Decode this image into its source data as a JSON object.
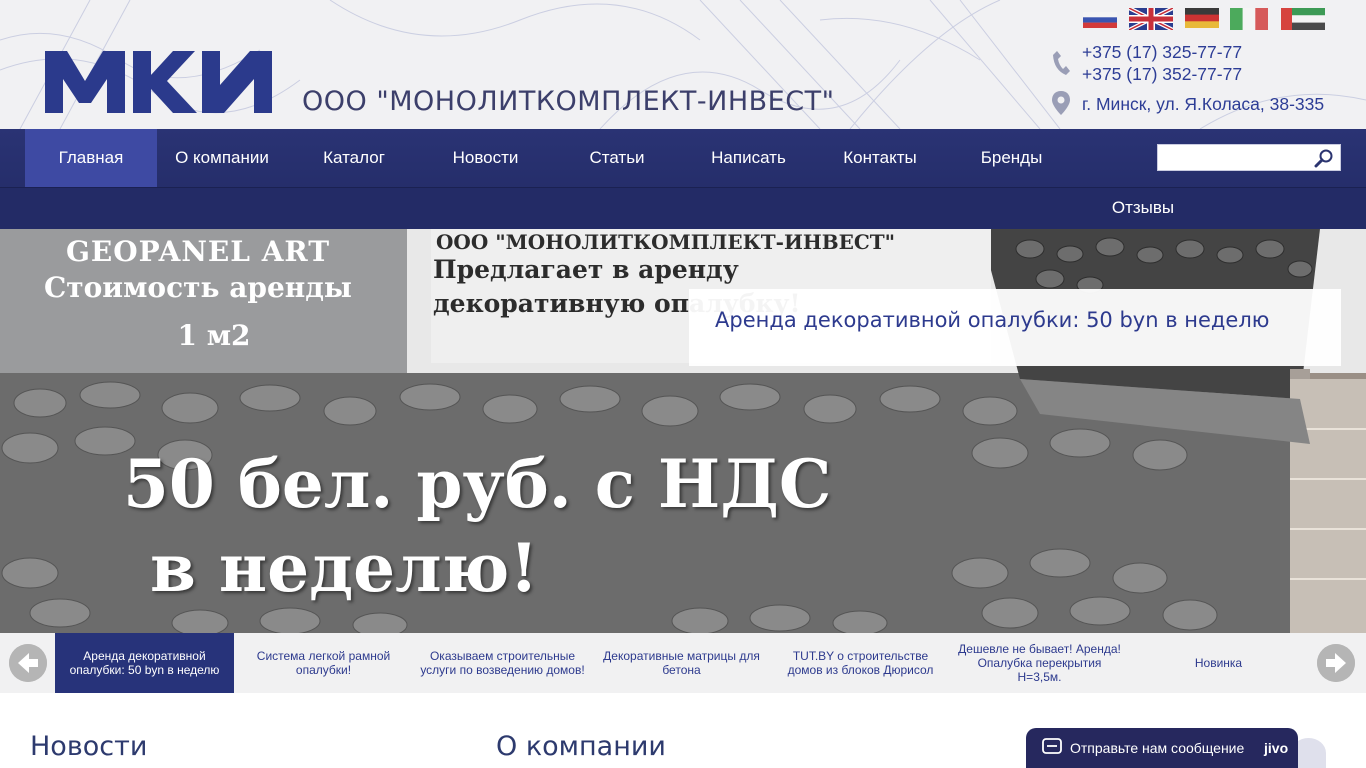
{
  "header": {
    "company_name": "ООО \"МОНОЛИТКОМПЛЕКТ-ИНВЕСТ\"",
    "logo_text": "МКИ",
    "languages": [
      "ru",
      "en",
      "de",
      "it",
      "ae"
    ],
    "phone1": "+375 (17) 325-77-77",
    "phone2": "+375 (17) 352-77-77",
    "address": "г. Минск, ул. Я.Коласа, 38-335"
  },
  "nav": {
    "items": [
      "Главная",
      "О компании",
      "Каталог",
      "Новости",
      "Статьи",
      "Написать",
      "Контакты",
      "Бренды",
      "Отзывы"
    ],
    "active_index": 0,
    "search_placeholder": ""
  },
  "slider": {
    "left_box": [
      "GEOPANEL ART",
      "Стоимость аренды",
      "1 м2"
    ],
    "mid_lines": [
      "ООО \"МОНОЛИТКОМПЛЕКТ-ИНВЕСТ\"",
      "Предлагает в аренду",
      "декоративную опалубку!"
    ],
    "caption": "Аренда декоративной опалубки: 50 byn в неделю",
    "price_line": "50 бел. руб. с НДС",
    "week_line": "в неделю!"
  },
  "thumbs": {
    "items": [
      "Аренда декоративной опалубки: 50 byn в неделю",
      "Система легкой рамной опалубки!",
      "Оказываем строительные услуги по возведению домов!",
      "Декоративные матрицы для бетона",
      "TUT.BY о строительстве домов из блоков Дюрисол",
      "Дешевле не бывает! Аренда! Опалубка перекрытия H=3,5м.",
      "Новинка"
    ],
    "active_index": 0
  },
  "sections": {
    "news_title": "Новости",
    "about_title": "О компании"
  },
  "chat": {
    "label": "Отправьте нам сообщение",
    "brand": "jivo"
  },
  "colors": {
    "brand_blue": "#2d3a8e",
    "nav_bg": "#232b66",
    "nav_active": "#3e4aa3",
    "thumb_active": "#27337a"
  }
}
